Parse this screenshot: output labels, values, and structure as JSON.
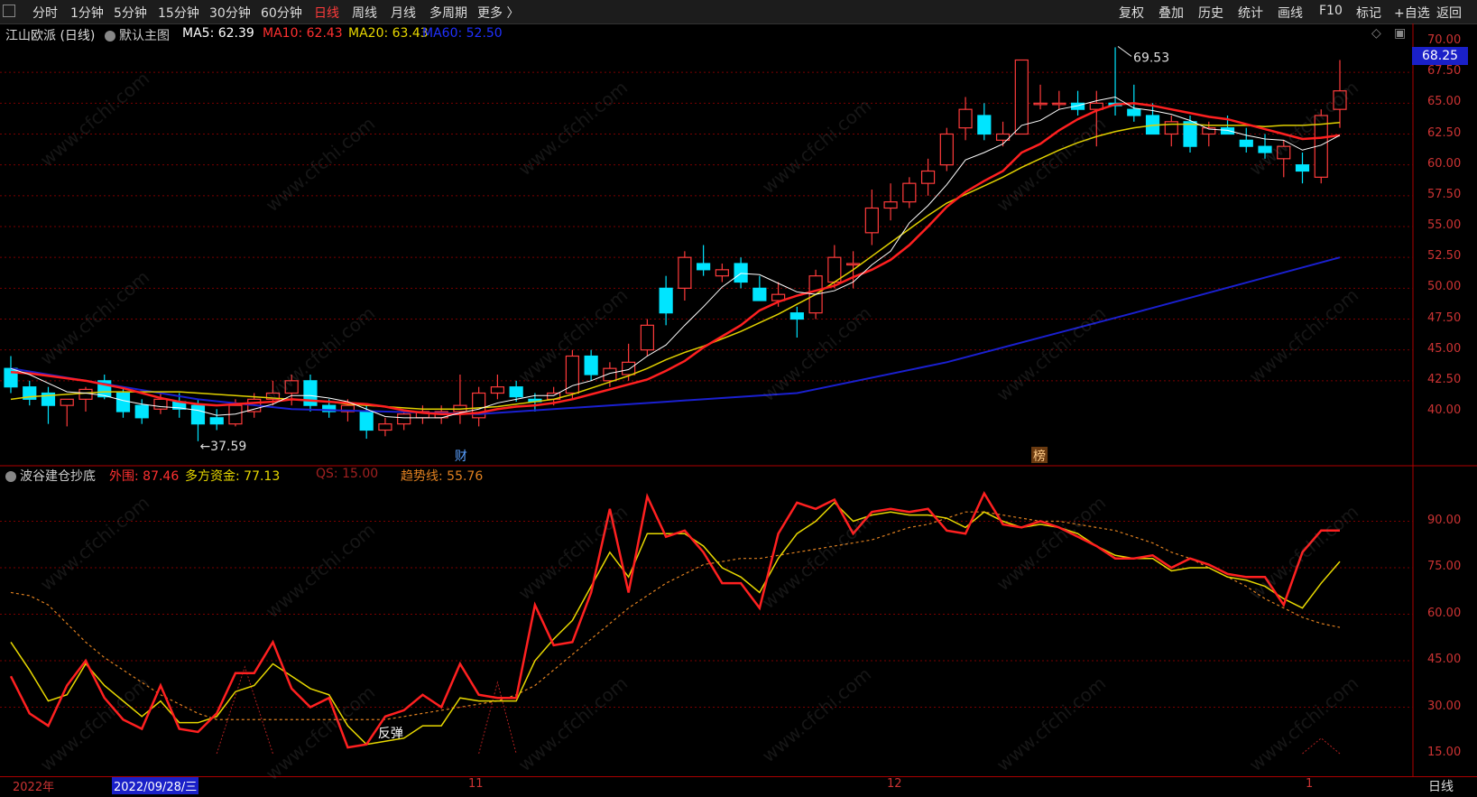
{
  "toolbar": {
    "left_items": [
      "分时",
      "1分钟",
      "5分钟",
      "15分钟",
      "30分钟",
      "60分钟",
      "日线",
      "周线",
      "月线",
      "多周期",
      "更多 〉"
    ],
    "active": "日线",
    "right_items": [
      "复权",
      "叠加",
      "历史",
      "统计",
      "画线",
      "F10",
      "标记",
      "+自选",
      "返回"
    ]
  },
  "main_chart": {
    "title": "江山欧派 (日线)",
    "mode": "默认主图",
    "ma5": "MA5: 62.39",
    "ma10": "MA10: 62.43",
    "ma20": "MA20: 63.43",
    "ma60": "MA60: 52.50",
    "current_price": "68.25",
    "high_label": "69.53",
    "low_label": "37.59",
    "y_ticks": [
      "70.00",
      "67.50",
      "65.00",
      "62.50",
      "60.00",
      "57.50",
      "55.00",
      "52.50",
      "50.00",
      "47.50",
      "45.00",
      "42.50",
      "40.00"
    ],
    "marker_cai": "财",
    "marker_bang": "榜"
  },
  "indicator": {
    "name": "波谷建仓抄底",
    "waiwei": "外围: 87.46",
    "duofang": "多方资金: 77.13",
    "qs": "QS: 15.00",
    "trend": "趋势线: 55.76",
    "rebound": "反弹",
    "y_ticks": [
      "90.00",
      "75.00",
      "60.00",
      "45.00",
      "30.00",
      "15.00"
    ]
  },
  "date_axis": {
    "year": "2022年",
    "selected_date": "2022/09/28/三",
    "month_11": "11",
    "month_12": "12",
    "month_1": "1",
    "freq": "日线"
  },
  "watermark": "www.cfchi.com",
  "colors": {
    "up": "#ff3b3b",
    "down": "#00e5ff",
    "ma5": "#ffffff",
    "ma10": "#ff2020",
    "ma20": "#e0d000",
    "ma60": "#1a20d0",
    "grid": "#7a0000"
  },
  "chart_data": {
    "type": "candlestick",
    "candles": [
      [
        43.5,
        44.5,
        41.5,
        42.0
      ],
      [
        42.0,
        42.5,
        40.5,
        41.0
      ],
      [
        41.5,
        42.0,
        39.0,
        40.5
      ],
      [
        40.5,
        41.0,
        38.8,
        41.0
      ],
      [
        41.0,
        42.0,
        40.0,
        41.8
      ],
      [
        42.5,
        43.0,
        41.0,
        41.2
      ],
      [
        41.5,
        42.0,
        39.5,
        40.0
      ],
      [
        40.5,
        41.0,
        39.0,
        39.5
      ],
      [
        40.2,
        41.5,
        39.8,
        41.0
      ],
      [
        40.8,
        41.5,
        39.5,
        40.2
      ],
      [
        40.5,
        41.0,
        37.6,
        39.0
      ],
      [
        39.5,
        40.2,
        38.5,
        39.0
      ],
      [
        39.0,
        41.0,
        38.8,
        40.5
      ],
      [
        40.0,
        41.5,
        39.5,
        41.0
      ],
      [
        41.0,
        42.5,
        40.5,
        41.5
      ],
      [
        41.5,
        43.0,
        40.5,
        42.5
      ],
      [
        42.5,
        43.0,
        40.0,
        40.5
      ],
      [
        40.5,
        41.0,
        39.5,
        40.0
      ],
      [
        40.0,
        41.0,
        39.2,
        40.5
      ],
      [
        40.0,
        40.5,
        37.8,
        38.5
      ],
      [
        38.5,
        39.5,
        38.0,
        39.0
      ],
      [
        39.0,
        40.0,
        38.5,
        39.8
      ],
      [
        39.5,
        40.5,
        39.0,
        40.0
      ],
      [
        39.5,
        40.5,
        39.0,
        40.0
      ],
      [
        40.0,
        43.0,
        39.0,
        40.5
      ],
      [
        39.5,
        42.0,
        38.8,
        41.5
      ],
      [
        41.5,
        43.0,
        41.0,
        42.0
      ],
      [
        42.0,
        42.5,
        40.8,
        41.2
      ],
      [
        41.0,
        41.5,
        40.0,
        40.8
      ],
      [
        41.0,
        42.0,
        40.5,
        41.5
      ],
      [
        41.5,
        45.0,
        41.0,
        44.5
      ],
      [
        44.5,
        45.0,
        42.5,
        43.0
      ],
      [
        42.5,
        44.0,
        42.0,
        43.5
      ],
      [
        43.0,
        45.5,
        42.5,
        44.0
      ],
      [
        45.0,
        47.5,
        44.5,
        47.0
      ],
      [
        50.0,
        51.0,
        47.0,
        48.0
      ],
      [
        50.0,
        53.0,
        49.0,
        52.5
      ],
      [
        52.0,
        53.5,
        51.0,
        51.5
      ],
      [
        51.0,
        52.0,
        50.5,
        51.5
      ],
      [
        52.0,
        52.5,
        50.0,
        50.5
      ],
      [
        50.0,
        51.0,
        49.0,
        49.0
      ],
      [
        49.0,
        50.5,
        48.5,
        49.5
      ],
      [
        48.0,
        48.5,
        46.0,
        47.5
      ],
      [
        48.0,
        51.5,
        47.5,
        51.0
      ],
      [
        50.5,
        53.5,
        50.0,
        52.5
      ],
      [
        52.0,
        53.0,
        50.0,
        52.0
      ],
      [
        54.5,
        58.0,
        53.5,
        56.5
      ],
      [
        56.5,
        58.5,
        55.5,
        57.0
      ],
      [
        57.0,
        59.0,
        56.5,
        58.5
      ],
      [
        58.5,
        60.5,
        57.5,
        59.5
      ],
      [
        60.0,
        63.0,
        59.5,
        62.5
      ],
      [
        63.0,
        65.5,
        62.0,
        64.5
      ],
      [
        64.0,
        65.0,
        62.0,
        62.5
      ],
      [
        62.0,
        63.5,
        61.5,
        62.5
      ],
      [
        62.5,
        68.5,
        62.5,
        68.5
      ],
      [
        65.0,
        66.5,
        64.5,
        65.0
      ],
      [
        65.0,
        66.0,
        64.5,
        65.0
      ],
      [
        65.0,
        66.0,
        64.0,
        64.5
      ],
      [
        64.5,
        66.0,
        61.5,
        65.0
      ],
      [
        65.0,
        69.53,
        64.0,
        64.8
      ],
      [
        64.5,
        66.5,
        63.5,
        64.0
      ],
      [
        64.0,
        65.0,
        62.5,
        62.5
      ],
      [
        62.5,
        64.0,
        61.5,
        63.5
      ],
      [
        63.5,
        64.0,
        61.0,
        61.5
      ],
      [
        62.5,
        63.5,
        61.5,
        63.0
      ],
      [
        63.0,
        64.0,
        62.5,
        62.5
      ],
      [
        62.0,
        63.0,
        61.0,
        61.5
      ],
      [
        61.5,
        62.5,
        60.5,
        61.0
      ],
      [
        60.5,
        62.0,
        59.0,
        61.5
      ],
      [
        60.0,
        61.0,
        58.5,
        59.5
      ],
      [
        59.0,
        64.5,
        58.5,
        64.0
      ],
      [
        64.5,
        68.5,
        63.0,
        66.0
      ]
    ],
    "ma5": [
      43.5,
      43.0,
      42.3,
      41.6,
      41.5,
      41.3,
      40.9,
      40.6,
      40.4,
      40.3,
      40.1,
      39.7,
      39.8,
      40.2,
      40.6,
      41.3,
      41.3,
      41.1,
      40.8,
      40.2,
      39.6,
      39.5,
      39.5,
      39.5,
      39.9,
      40.2,
      40.7,
      41.0,
      41.3,
      41.3,
      42.1,
      42.5,
      43.1,
      43.4,
      44.5,
      45.4,
      47.0,
      48.5,
      50.1,
      51.2,
      51.1,
      50.4,
      49.7,
      49.5,
      49.8,
      50.5,
      51.9,
      53.0,
      55.3,
      56.7,
      58.4,
      60.4,
      61.0,
      61.7,
      63.2,
      63.6,
      64.5,
      64.8,
      65.2,
      65.5,
      64.6,
      64.4,
      64.1,
      63.6,
      62.9,
      62.8,
      62.4,
      62.1,
      62.0,
      61.2,
      61.6,
      62.4
    ],
    "ma10": [
      43.2,
      43.1,
      42.9,
      42.7,
      42.5,
      42.2,
      41.9,
      41.5,
      41.1,
      40.8,
      40.6,
      40.5,
      40.6,
      40.7,
      40.8,
      41.0,
      40.9,
      40.8,
      40.7,
      40.6,
      40.4,
      40.1,
      39.9,
      39.8,
      39.8,
      39.9,
      40.2,
      40.4,
      40.5,
      40.7,
      41.0,
      41.4,
      41.8,
      42.2,
      42.6,
      43.3,
      44.1,
      45.2,
      46.1,
      47.0,
      48.2,
      48.9,
      49.4,
      49.8,
      50.2,
      50.9,
      51.5,
      52.3,
      53.5,
      55.0,
      56.6,
      57.8,
      58.7,
      59.5,
      61.0,
      61.7,
      62.8,
      63.7,
      64.4,
      64.9,
      65.0,
      64.8,
      64.5,
      64.2,
      63.9,
      63.7,
      63.3,
      62.9,
      62.5,
      62.1,
      62.2,
      62.4
    ],
    "ma20": [
      41.0,
      41.2,
      41.3,
      41.4,
      41.5,
      41.6,
      41.6,
      41.6,
      41.6,
      41.6,
      41.5,
      41.4,
      41.3,
      41.2,
      41.1,
      41.0,
      40.9,
      40.8,
      40.6,
      40.5,
      40.4,
      40.3,
      40.2,
      40.2,
      40.2,
      40.3,
      40.4,
      40.6,
      40.8,
      41.0,
      41.4,
      41.9,
      42.4,
      42.9,
      43.5,
      44.2,
      44.8,
      45.3,
      45.9,
      46.5,
      47.2,
      47.9,
      48.7,
      49.5,
      50.5,
      51.5,
      52.6,
      53.7,
      54.8,
      55.9,
      56.9,
      57.6,
      58.3,
      59.0,
      59.8,
      60.5,
      61.2,
      61.8,
      62.3,
      62.7,
      63.0,
      63.2,
      63.3,
      63.3,
      63.2,
      63.2,
      63.2,
      63.1,
      63.2,
      63.2,
      63.3,
      63.43
    ],
    "ma60": [
      {
        "i": 0,
        "v": 43.5
      },
      {
        "i": 10,
        "v": 41.0
      },
      {
        "i": 15,
        "v": 40.2
      },
      {
        "i": 25,
        "v": 39.8
      },
      {
        "i": 35,
        "v": 40.8
      },
      {
        "i": 42,
        "v": 41.5
      },
      {
        "i": 50,
        "v": 44.0
      },
      {
        "i": 60,
        "v": 48.0
      },
      {
        "i": 71,
        "v": 52.5
      }
    ],
    "ind_red": [
      40,
      28,
      24,
      37,
      45,
      33,
      26,
      23,
      37,
      23,
      22,
      28,
      41,
      41,
      51,
      36,
      30,
      33,
      17,
      18,
      27,
      29,
      34,
      30,
      44,
      34,
      33,
      33,
      63,
      50,
      51,
      67,
      94,
      67,
      98,
      85,
      87,
      80,
      70,
      70,
      62,
      86,
      96,
      94,
      97,
      86,
      93,
      94,
      93,
      94,
      87,
      86,
      99,
      89,
      88,
      90,
      88,
      85,
      82,
      78,
      78,
      79,
      75,
      78,
      76,
      73,
      72,
      72,
      63,
      80,
      87,
      87
    ],
    "ind_yellow": [
      51,
      42,
      32,
      34,
      44,
      37,
      32,
      27,
      32,
      25,
      25,
      27,
      35,
      37,
      44,
      40,
      36,
      34,
      24,
      18,
      19,
      20,
      24,
      24,
      33,
      32,
      32,
      32,
      45,
      52,
      58,
      69,
      80,
      72,
      86,
      86,
      86,
      82,
      75,
      72,
      67,
      78,
      86,
      90,
      96,
      90,
      92,
      93,
      92,
      92,
      91,
      88,
      93,
      90,
      88,
      89,
      88,
      86,
      82,
      79,
      78,
      78,
      74,
      75,
      75,
      72,
      71,
      69,
      65,
      62,
      70,
      77
    ],
    "ind_trend": [
      67,
      66,
      63,
      57,
      51,
      46,
      42,
      38,
      34,
      31,
      28,
      26,
      26,
      26,
      26,
      26,
      26,
      26,
      26,
      26,
      26,
      27,
      28,
      29,
      30,
      31,
      32,
      34,
      37,
      42,
      47,
      52,
      57,
      62,
      66,
      70,
      73,
      76,
      77,
      78,
      78,
      79,
      80,
      81,
      82,
      83,
      84,
      86,
      88,
      89,
      91,
      93,
      93,
      92,
      91,
      90,
      90,
      89,
      88,
      87,
      85,
      83,
      80,
      78,
      75,
      72,
      69,
      65,
      62,
      59,
      57,
      55.76
    ]
  }
}
